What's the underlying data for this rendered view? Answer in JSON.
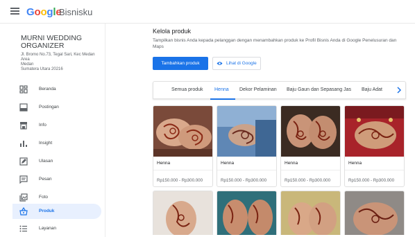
{
  "header": {
    "brand_letters": [
      {
        "ch": "G",
        "color": "#4285F4"
      },
      {
        "ch": "o",
        "color": "#EA4335"
      },
      {
        "ch": "o",
        "color": "#FBBC05"
      },
      {
        "ch": "g",
        "color": "#4285F4"
      },
      {
        "ch": "l",
        "color": "#34A853"
      },
      {
        "ch": "e",
        "color": "#EA4335"
      }
    ],
    "product": "Bisnisku"
  },
  "business": {
    "name": "MURNI WEDDING ORGANIZER",
    "address_line1": "Jl. Bromo No.73, Tegal Sari, Kec Medan Area",
    "address_line2": "Medan",
    "address_line3": "Sumatera Utara 20216"
  },
  "sidebar": {
    "items": [
      {
        "label": "Beranda",
        "icon": "home-dashboard-icon"
      },
      {
        "label": "Postingan",
        "icon": "posts-icon"
      },
      {
        "label": "Info",
        "icon": "info-store-icon"
      },
      {
        "label": "Insight",
        "icon": "insights-bar-icon"
      },
      {
        "label": "Ulasan",
        "icon": "reviews-icon"
      },
      {
        "label": "Pesan",
        "icon": "messages-icon"
      },
      {
        "label": "Foto",
        "icon": "photos-icon"
      },
      {
        "label": "Produk",
        "icon": "products-basket-icon",
        "active": true
      },
      {
        "label": "Layanan",
        "icon": "services-list-icon"
      }
    ]
  },
  "main": {
    "title": "Kelola produk",
    "description": "Tampilkan bisnis Anda kepada pelanggan dengan menambahkan produk ke Profil Bisnis Anda di Google Penelusuran dan Maps",
    "add_button": "Tambahkan produk",
    "view_button": "Lihat di Google",
    "tabs": [
      "Semua produk",
      "Henna",
      "Dekor Pelaminan",
      "Baju Gaun dan Sepasang Jas",
      "Baju Adat"
    ],
    "active_tab": "Henna",
    "products": [
      {
        "name": "Henna",
        "price": "Rp150.000 - Rp300.000"
      },
      {
        "name": "Henna",
        "price": "Rp150.000 - Rp300.000"
      },
      {
        "name": "Henna",
        "price": "Rp150.000 - Rp300.000"
      },
      {
        "name": "Henna",
        "price": "Rp150.000 - Rp300.000"
      }
    ]
  },
  "colors": {
    "accent": "#1a73e8",
    "active_nav_bg": "#e8f0fe"
  }
}
